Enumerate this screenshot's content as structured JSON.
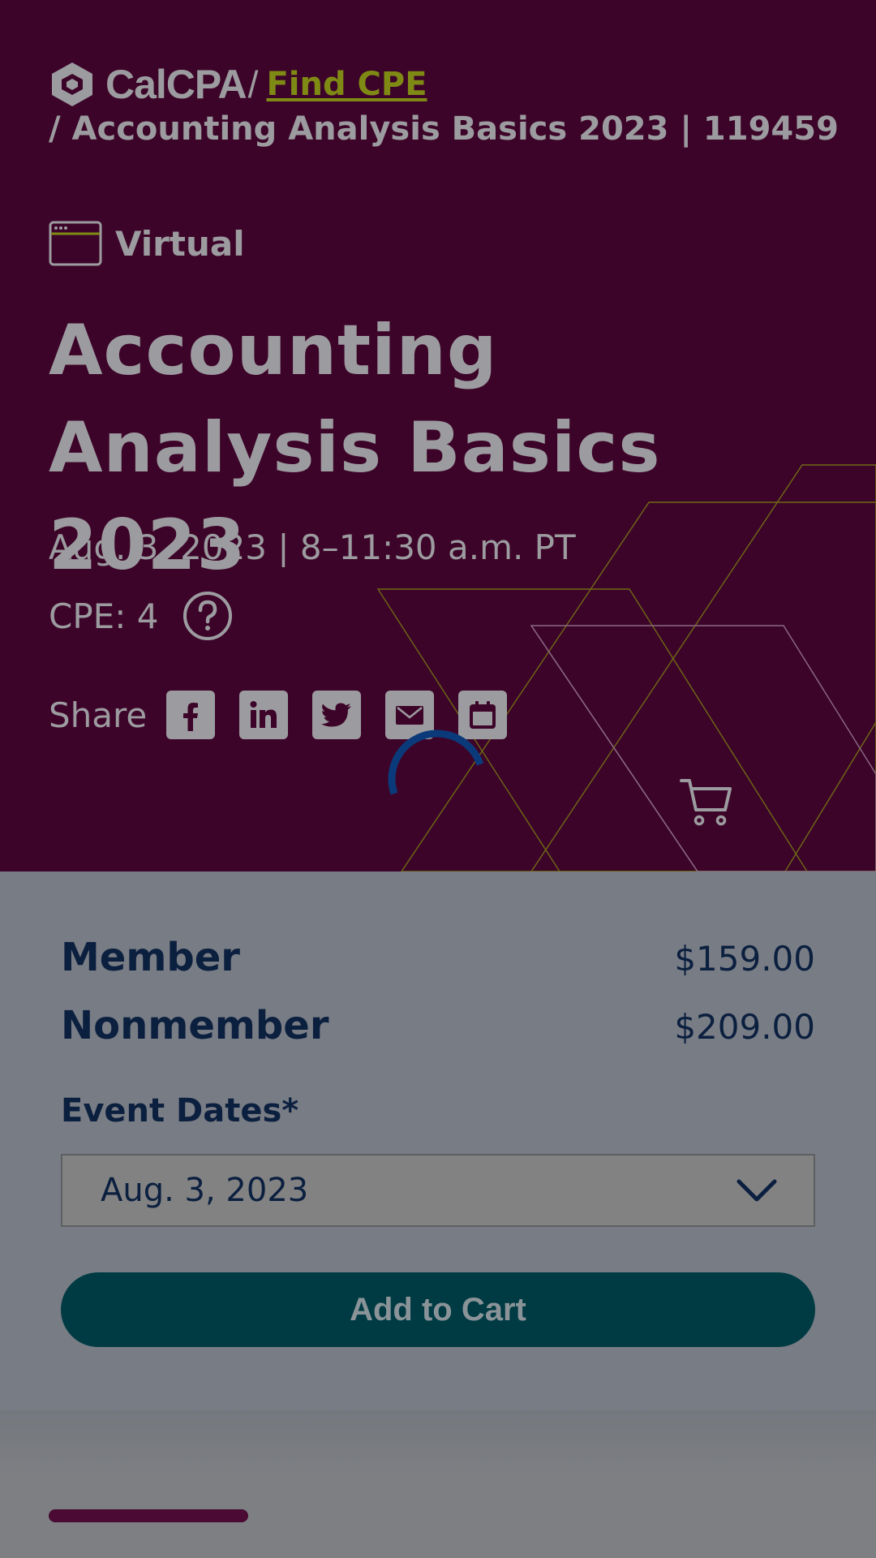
{
  "header": {
    "logo_text": "CalCPA",
    "separator": "/",
    "find_cpe_link": "Find CPE",
    "breadcrumb_tail": "/ Accounting Analysis Basics 2023 | 119459"
  },
  "event": {
    "format_label": "Virtual",
    "title": "Accounting Analysis Basics 2023",
    "datetime": "Aug. 3, 2023 | 8–11:30 a.m. PT",
    "cpe_label": "CPE: 4",
    "share_label": "Share",
    "share_icons": [
      "facebook-icon",
      "linkedin-icon",
      "twitter-icon",
      "email-icon",
      "calendar-icon"
    ]
  },
  "pricing": {
    "member_label": "Member",
    "member_price": "$159.00",
    "nonmember_label": "Nonmember",
    "nonmember_price": "$209.00"
  },
  "registration": {
    "event_dates_label": "Event Dates*",
    "selected_date": "Aug. 3, 2023",
    "add_to_cart": "Add to Cart"
  },
  "colors": {
    "hero_bg": "#3d0429",
    "link_olive": "#7f8a15",
    "text_navy": "#0b1f3f",
    "button_teal": "#003b44",
    "spinner_blue": "#0b3a7a"
  }
}
